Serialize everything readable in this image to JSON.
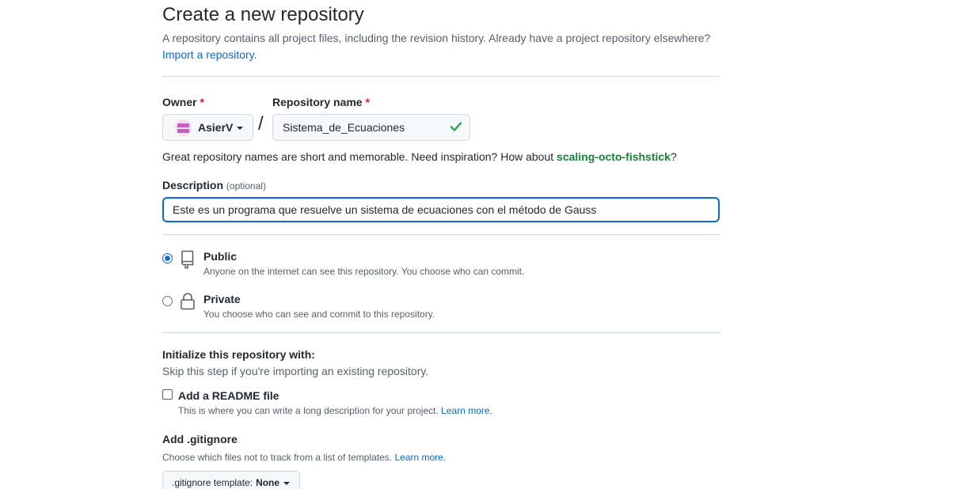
{
  "header": {
    "title": "Create a new repository",
    "subtitle": "A repository contains all project files, including the revision history. Already have a project repository elsewhere?",
    "import_link": "Import a repository",
    "import_suffix": "."
  },
  "owner": {
    "label": "Owner",
    "required_mark": "*",
    "value": "AsierV"
  },
  "slash": "/",
  "repo_name": {
    "label": "Repository name",
    "required_mark": "*",
    "value": "Sistema_de_Ecuaciones",
    "valid_color": "#2da44e"
  },
  "name_hint": {
    "text": "Great repository names are short and memorable. Need inspiration? How about ",
    "suggestion": "scaling-octo-fishstick",
    "suffix": "?"
  },
  "description": {
    "label": "Description",
    "optional": "(optional)",
    "value": "Este es un programa que resuelve un sistema de ecuaciones con el método de Gauss"
  },
  "visibility": {
    "selected": "public",
    "public": {
      "title": "Public",
      "desc": "Anyone on the internet can see this repository. You choose who can commit.",
      "icon": "repo-icon"
    },
    "private": {
      "title": "Private",
      "desc": "You choose who can see and commit to this repository.",
      "icon": "lock-icon"
    }
  },
  "initialize": {
    "title": "Initialize this repository with:",
    "subtitle": "Skip this step if you're importing an existing repository.",
    "readme": {
      "label": "Add a README file",
      "desc": "This is where you can write a long description for your project.",
      "learn_more": "Learn more."
    }
  },
  "gitignore": {
    "title": "Add .gitignore",
    "desc": "Choose which files not to track from a list of templates.",
    "learn_more": "Learn more.",
    "button_label": ".gitignore template:",
    "button_value": "None"
  },
  "colors": {
    "accent": "#0969da",
    "success": "#1a7f37",
    "danger": "#cf222e"
  }
}
